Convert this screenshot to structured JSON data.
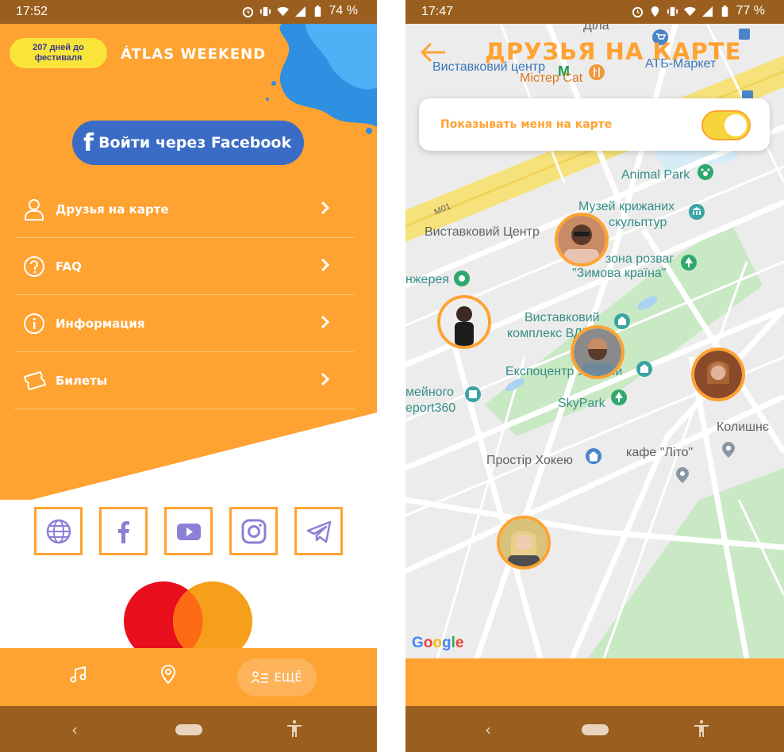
{
  "left_screen": {
    "status_bar": {
      "time": "17:52",
      "battery": "74 %"
    },
    "countdown_badge": "207 дней до фестиваля",
    "brand_logo": "ÁTLAS WEEKEND",
    "facebook_login_label": "Войти через Facebook",
    "menu": {
      "items": [
        {
          "label": "Друзья на карте",
          "icon": "user-icon"
        },
        {
          "label": "FAQ",
          "icon": "question-icon"
        },
        {
          "label": "Информация",
          "icon": "info-icon"
        },
        {
          "label": "Билеты",
          "icon": "ticket-icon"
        }
      ]
    },
    "social_links": [
      "globe-icon",
      "facebook-icon",
      "youtube-icon",
      "instagram-icon",
      "telegram-icon"
    ],
    "bottom_tabs": {
      "more_label": "ЕЩЁ"
    },
    "colors": {
      "accent": "#fea231",
      "facebook_blue": "#3a6cc6",
      "badge_yellow": "#f9e43a",
      "icon_purple": "#8a80d6"
    }
  },
  "right_screen": {
    "status_bar": {
      "time": "17:47",
      "battery": "77 %"
    },
    "title": "ДРУЗЬЯ НА КАРТЕ",
    "show_me_toggle": {
      "label": "Показывать меня на карте",
      "on": true
    },
    "map_labels": {
      "dila": "Діла",
      "vystavkovyi_tsentr_top": "Виставковий центр",
      "mister_cat": "Містер Cat",
      "atb": "АТБ-Маркет",
      "animal_park": "Animal Park",
      "muzei_1": "Музей крижаних",
      "muzei_2": "скульптур",
      "m01": "М01",
      "vystavkovyi_tsentr_mid": "Виставковий Центр",
      "rozvah_1": "зона розваг",
      "rozvah_2": "\"Зимова країна\"",
      "oranzhereia": "нжерея",
      "kompleks_1": "Виставковий",
      "kompleks_2": "комплекс ВДНГ",
      "ekspotsentr": "Експоцентр України",
      "simeinoho_1": "мейного",
      "simeinoho_2": "eport360",
      "skypark": "SkyPark",
      "kolyshnie": "Колишнє",
      "prostir": "Простір Хокею",
      "kafe_lito": "кафе \"Літо\"",
      "google": "Google"
    },
    "friend_avatars": [
      "friend-avatar-1",
      "friend-avatar-2",
      "friend-avatar-3",
      "friend-avatar-4",
      "friend-avatar-5"
    ]
  }
}
